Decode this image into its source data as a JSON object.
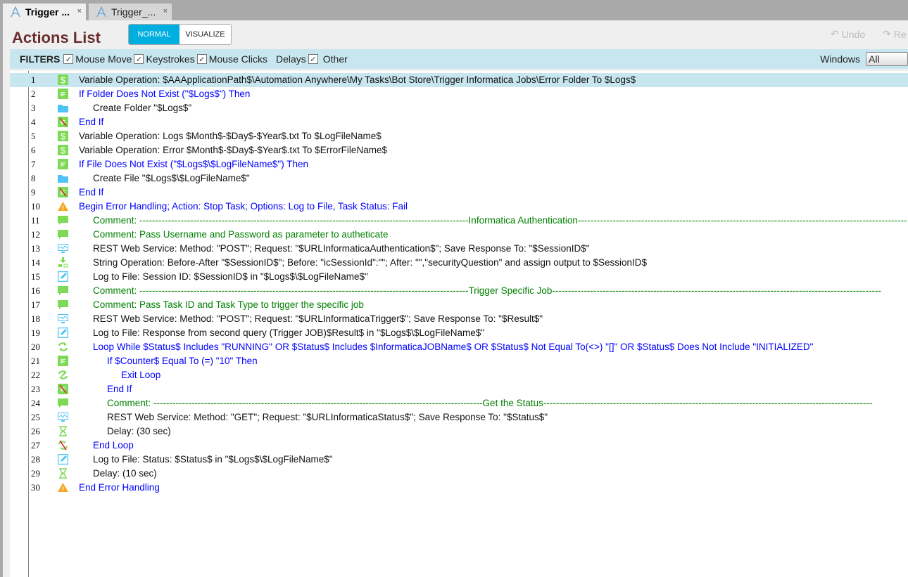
{
  "tabs": [
    {
      "label": "Trigger ...",
      "close": "×"
    },
    {
      "label": "Trigger_...",
      "close": "×"
    }
  ],
  "header": {
    "title": "Actions List",
    "mode_normal": "NORMAL",
    "mode_visualize": "VISUALIZE",
    "undo": "Undo",
    "redo": "Re"
  },
  "filters": {
    "label": "FILTERS",
    "items": [
      "Mouse Move",
      "Keystrokes",
      "Mouse Clicks",
      "Delays",
      "Other"
    ],
    "windows_label": "Windows",
    "windows_value": "All"
  },
  "colors": {
    "accent": "#00aee0",
    "filter_bar": "#c7e6ef",
    "flow": "#0000ff",
    "comment": "#008000",
    "icon_green": "#7ed957"
  },
  "actions": [
    {
      "n": "1",
      "icon": "dollar",
      "indent": 0,
      "kind": "normal",
      "text": "Variable Operation: $AAApplicationPath$\\Automation Anywhere\\My Tasks\\Bot Store\\Trigger Informatica Jobs\\Error Folder To $Logs$"
    },
    {
      "n": "2",
      "icon": "if",
      "indent": 0,
      "kind": "flow",
      "text": "If Folder Does Not Exist (\"$Logs$\")  Then"
    },
    {
      "n": "3",
      "icon": "folder",
      "indent": 1,
      "kind": "normal",
      "text": "Create Folder \"$Logs$\""
    },
    {
      "n": "4",
      "icon": "endif",
      "indent": 0,
      "kind": "flow",
      "text": "End If"
    },
    {
      "n": "5",
      "icon": "dollar",
      "indent": 0,
      "kind": "normal",
      "text": "Variable Operation: Logs $Month$-$Day$-$Year$.txt To $LogFileName$"
    },
    {
      "n": "6",
      "icon": "dollar",
      "indent": 0,
      "kind": "normal",
      "text": "Variable Operation: Error $Month$-$Day$-$Year$.txt To $ErrorFileName$"
    },
    {
      "n": "7",
      "icon": "if",
      "indent": 0,
      "kind": "flow",
      "text": "If File Does Not Exist (\"$Logs$\\$LogFileName$\")  Then"
    },
    {
      "n": "8",
      "icon": "folder",
      "indent": 1,
      "kind": "normal",
      "text": "Create File \"$Logs$\\$LogFileName$\""
    },
    {
      "n": "9",
      "icon": "endif",
      "indent": 0,
      "kind": "flow",
      "text": "End If"
    },
    {
      "n": "10",
      "icon": "warning",
      "indent": 0,
      "kind": "flow",
      "text": "Begin Error Handling; Action: Stop Task; Options: Log to File,  Task Status: Fail"
    },
    {
      "n": "11",
      "icon": "comment",
      "indent": 1,
      "kind": "comment",
      "text": "Comment: --------------------------------------------------------------------------------------------------------Informatica Authentication--------------------------------------------------------------------------------------------------------"
    },
    {
      "n": "12",
      "icon": "comment",
      "indent": 1,
      "kind": "comment",
      "text": "Comment: Pass Username and Password as parameter to autheticate"
    },
    {
      "n": "13",
      "icon": "rest",
      "indent": 1,
      "kind": "normal",
      "text": "REST Web Service: Method: \"POST\"; Request: \"$URLInformaticaAuthentication$\"; Save Response To: \"$SessionID$\""
    },
    {
      "n": "14",
      "icon": "string",
      "indent": 1,
      "kind": "normal",
      "text": "String Operation: Before-After \"$SessionID$\"; Before: \"icSessionId\":\"\"; After: \"\",\"securityQuestion\" and assign output to $SessionID$"
    },
    {
      "n": "15",
      "icon": "log",
      "indent": 1,
      "kind": "normal",
      "text": "Log to File: Session ID: $SessionID$ in \"$Logs$\\$LogFileName$\""
    },
    {
      "n": "16",
      "icon": "comment",
      "indent": 1,
      "kind": "comment",
      "text": "Comment: --------------------------------------------------------------------------------------------------------Trigger Specific Job--------------------------------------------------------------------------------------------------------"
    },
    {
      "n": "17",
      "icon": "comment",
      "indent": 1,
      "kind": "comment",
      "text": "Comment: Pass Task ID and Task Type to trigger the specific job"
    },
    {
      "n": "18",
      "icon": "rest",
      "indent": 1,
      "kind": "normal",
      "text": "REST Web Service: Method: \"POST\"; Request: \"$URLInformaticaTrigger$\"; Save Response To: \"$Result$\""
    },
    {
      "n": "19",
      "icon": "log",
      "indent": 1,
      "kind": "normal",
      "text": "Log to File: Response from second query (Trigger JOB)$Result$ in \"$Logs$\\$LogFileName$\""
    },
    {
      "n": "20",
      "icon": "loop",
      "indent": 1,
      "kind": "flow",
      "text": "Loop While $Status$ Includes \"RUNNING\" OR $Status$ Includes $InformaticaJOBName$ OR $Status$ Not Equal To(<>) \"[]\" OR $Status$ Does Not Include \"INITIALIZED\""
    },
    {
      "n": "21",
      "icon": "if",
      "indent": 2,
      "kind": "flow",
      "text": "If $Counter$ Equal To (=) \"10\" Then"
    },
    {
      "n": "22",
      "icon": "exitloop",
      "indent": 3,
      "kind": "flow",
      "text": "Exit Loop"
    },
    {
      "n": "23",
      "icon": "endif",
      "indent": 2,
      "kind": "flow",
      "text": "End If"
    },
    {
      "n": "24",
      "icon": "comment",
      "indent": 2,
      "kind": "comment",
      "text": "Comment: --------------------------------------------------------------------------------------------------------Get the Status--------------------------------------------------------------------------------------------------------"
    },
    {
      "n": "25",
      "icon": "rest",
      "indent": 2,
      "kind": "normal",
      "text": "REST Web Service: Method: \"GET\"; Request: \"$URLInformaticaStatus$\"; Save Response To: \"$Status$\""
    },
    {
      "n": "26",
      "icon": "delay",
      "indent": 2,
      "kind": "normal",
      "text": "Delay: (30 sec)"
    },
    {
      "n": "27",
      "icon": "endloop",
      "indent": 1,
      "kind": "flow",
      "text": "End Loop"
    },
    {
      "n": "28",
      "icon": "log",
      "indent": 1,
      "kind": "normal",
      "text": "Log to File: Status: $Status$ in \"$Logs$\\$LogFileName$\""
    },
    {
      "n": "29",
      "icon": "delay",
      "indent": 1,
      "kind": "normal",
      "text": "Delay: (10 sec)"
    },
    {
      "n": "30",
      "icon": "warning",
      "indent": 0,
      "kind": "flow",
      "text": "End Error Handling"
    }
  ]
}
